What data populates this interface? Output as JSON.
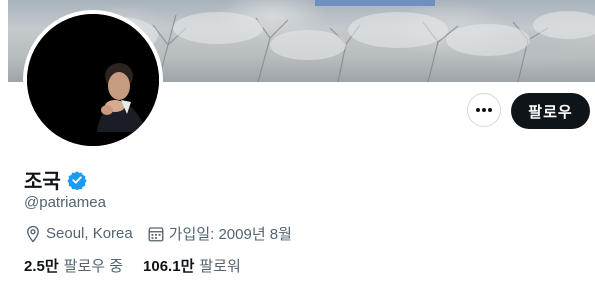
{
  "profile": {
    "name": "조국",
    "handle": "@patriamea",
    "location": "Seoul, Korea",
    "joined": "가입일: 2009년 8월",
    "verified": true
  },
  "actions": {
    "follow_label": "팔로우",
    "more_icon": "more-dots-icon"
  },
  "stats": {
    "following_count": "2.5만",
    "following_label": "팔로우 중",
    "followers_count": "106.1만",
    "followers_label": "팔로워"
  },
  "colors": {
    "primary_text": "#0f1419",
    "secondary_text": "#536471",
    "verified_badge": "#1d9bf0",
    "follow_button_bg": "#0f1419",
    "border": "#cfd9de"
  }
}
